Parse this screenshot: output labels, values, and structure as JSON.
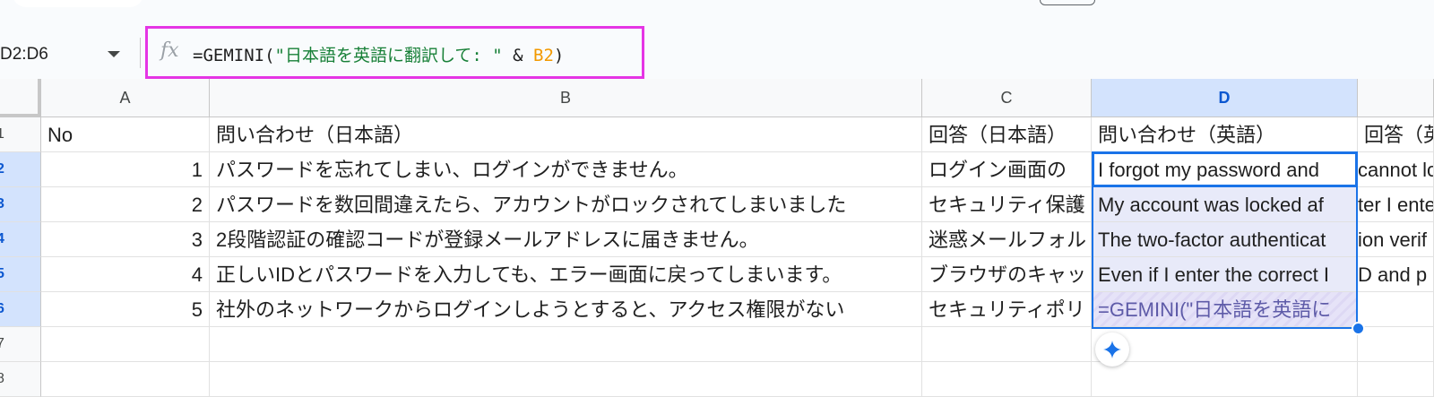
{
  "name_box": {
    "value": "D2:D6"
  },
  "formula_bar": {
    "fx_label": "fx",
    "formula_prefix": "=GEMINI(",
    "formula_string": "\"日本語を英語に翻訳して: \"",
    "formula_operator": " & ",
    "formula_reference": "B2",
    "formula_suffix": ")"
  },
  "columns": [
    {
      "label": "A"
    },
    {
      "label": "B"
    },
    {
      "label": "C"
    },
    {
      "label": "D",
      "selected": true
    }
  ],
  "row_numbers": [
    "1",
    "2",
    "3",
    "4",
    "5",
    "6",
    "7",
    "8"
  ],
  "rows": [
    {
      "a": "No",
      "b": "問い合わせ（日本語）",
      "c": "回答（日本語）",
      "d": "問い合わせ（英語）",
      "e": "回答（英"
    },
    {
      "a": "1",
      "b": "パスワードを忘れてしまい、ログインができません。",
      "c": "ログイン画面の",
      "d": "I forgot my password and",
      "e": "cannot lo"
    },
    {
      "a": "2",
      "b": "パスワードを数回間違えたら、アカウントがロックされてしまいました",
      "c": "セキュリティ保護",
      "d": "My account was locked af",
      "e": "ter I ente"
    },
    {
      "a": "3",
      "b": "2段階認証の確認コードが登録メールアドレスに届きません。",
      "c": "迷惑メールフォル",
      "d": "The two-factor authenticat",
      "e": "ion verif"
    },
    {
      "a": "4",
      "b": "正しいIDとパスワードを入力しても、エラー画面に戻ってしまいます。",
      "c": "ブラウザのキャッ",
      "d": "Even if I enter the correct I",
      "e": "D and p"
    },
    {
      "a": "5",
      "b": "社外のネットワークからログインしようとすると、アクセス権限がない",
      "c": "セキュリティポリ",
      "d": "=GEMINI(\"日本語を英語に",
      "e": ""
    }
  ],
  "colors": {
    "selection": "#1a73e8",
    "highlight_border": "#e535e5",
    "formula_string": "#188038",
    "formula_reference": "#f29900"
  }
}
